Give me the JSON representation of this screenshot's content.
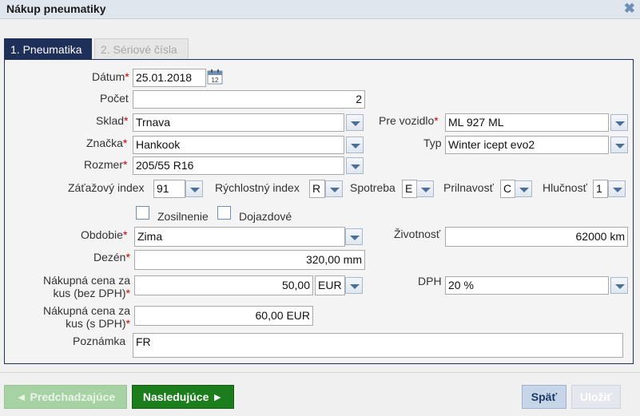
{
  "window": {
    "title": "Nákup pneumatiky",
    "close": "✖"
  },
  "tabs": [
    {
      "label": "1. Pneumatika"
    },
    {
      "label": "2. Sériové čísla"
    }
  ],
  "form": {
    "datum": {
      "label": "Dátum",
      "value": "25.01.2018"
    },
    "pocet": {
      "label": "Počet",
      "value": "2"
    },
    "sklad": {
      "label": "Sklad",
      "value": "Trnava"
    },
    "pre_vozidlo": {
      "label": "Pre vozidlo",
      "value": "ML 927 ML"
    },
    "znacka": {
      "label": "Značka",
      "value": "Hankook"
    },
    "typ": {
      "label": "Typ",
      "value": "Winter icept evo2"
    },
    "rozmer": {
      "label": "Rozmer",
      "value": "205/55 R16"
    },
    "zatazovy_index": {
      "label": "Záťažový index",
      "value": "91"
    },
    "rychlostny_index": {
      "label": "Rýchlostný index",
      "value": "R"
    },
    "spotreba": {
      "label": "Spotreba",
      "value": "E"
    },
    "prilnavost": {
      "label": "Prilnavosť",
      "value": "C"
    },
    "hlucnost": {
      "label": "Hlučnosť",
      "value": "1"
    },
    "zosilnenie": {
      "label": "Zosilnenie"
    },
    "dojazdove": {
      "label": "Dojazdové"
    },
    "obdobie": {
      "label": "Obdobie",
      "value": "Zima"
    },
    "zivotnost": {
      "label": "Životnosť",
      "value": "62000 km"
    },
    "dezen": {
      "label": "Dezén",
      "value": "320,00 mm"
    },
    "cena_bez_dph": {
      "label_line1": "Nákupná cena za",
      "label_line2": "kus (bez DPH)",
      "value": "50,00",
      "currency": "EUR"
    },
    "dph": {
      "label": "DPH",
      "value": "20 %"
    },
    "cena_s_dph": {
      "label_line1": "Nákupná cena za",
      "label_line2": "kus (s DPH)",
      "value": "60,00 EUR"
    },
    "poznamka": {
      "label": "Poznámka",
      "value": "FR"
    },
    "required_mark": "*"
  },
  "calendar": {
    "day": "12"
  },
  "buttons": {
    "prev": "◄ Predchadzajúce",
    "next": "Nasledujúce ►",
    "back": "Späť",
    "save": "Uložiť"
  }
}
